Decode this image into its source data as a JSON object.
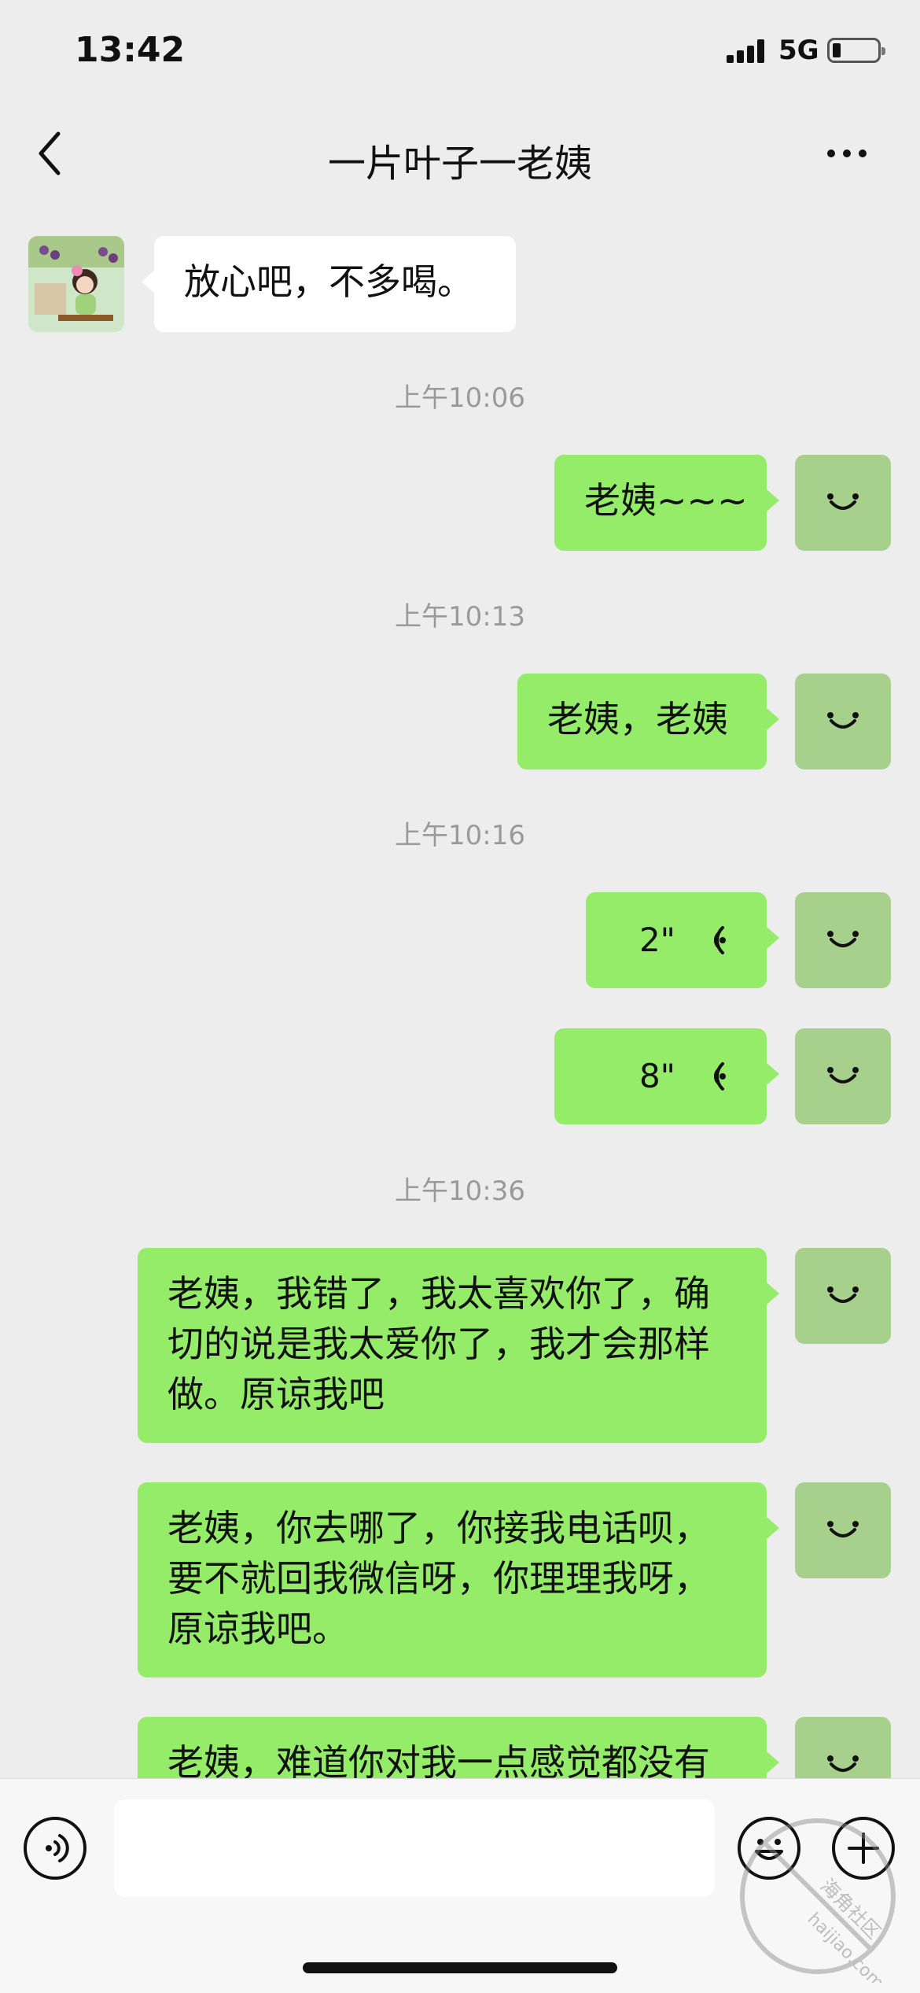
{
  "status_bar": {
    "time": "13:42",
    "network": "5G",
    "icons": [
      "signal-icon",
      "battery-icon"
    ]
  },
  "nav": {
    "title": "一片叶子一老姨",
    "back_icon": "chevron-left-icon",
    "more_icon": "more-dots-icon"
  },
  "messages": [
    {
      "from": "other",
      "type": "text",
      "text": "放心吧，不多喝。"
    },
    {
      "type": "time",
      "text": "上午10:06"
    },
    {
      "from": "me",
      "type": "text",
      "text": "老姨~~~"
    },
    {
      "type": "time",
      "text": "上午10:13"
    },
    {
      "from": "me",
      "type": "text",
      "text": "老姨，老姨"
    },
    {
      "type": "time",
      "text": "上午10:16"
    },
    {
      "from": "me",
      "type": "voice",
      "duration": "2\""
    },
    {
      "from": "me",
      "type": "voice",
      "duration": "8\""
    },
    {
      "type": "time",
      "text": "上午10:36"
    },
    {
      "from": "me",
      "type": "text",
      "lines": [
        "老姨，我错了，我太喜欢你了，确",
        "切的说是我太爱你了，我才会那样",
        "做。原谅我吧"
      ]
    },
    {
      "from": "me",
      "type": "text",
      "lines": [
        "老姨，你去哪了，你接我电话呗，",
        "要不就回我微信呀，你理理我呀，",
        "原谅我吧。"
      ]
    },
    {
      "from": "me",
      "type": "text",
      "text": "老姨，难道你对我一点感觉都没有"
    }
  ],
  "input_bar": {
    "placeholder": "",
    "icons": [
      "voice-input-icon",
      "emoji-icon",
      "plus-icon"
    ]
  },
  "watermark": {
    "line1": "海角社区",
    "line2": "haijiao.com"
  },
  "colors": {
    "my_bubble": "#95ec69",
    "other_bubble": "#ffffff",
    "background": "#ededed",
    "my_avatar": "#a8d08d"
  }
}
